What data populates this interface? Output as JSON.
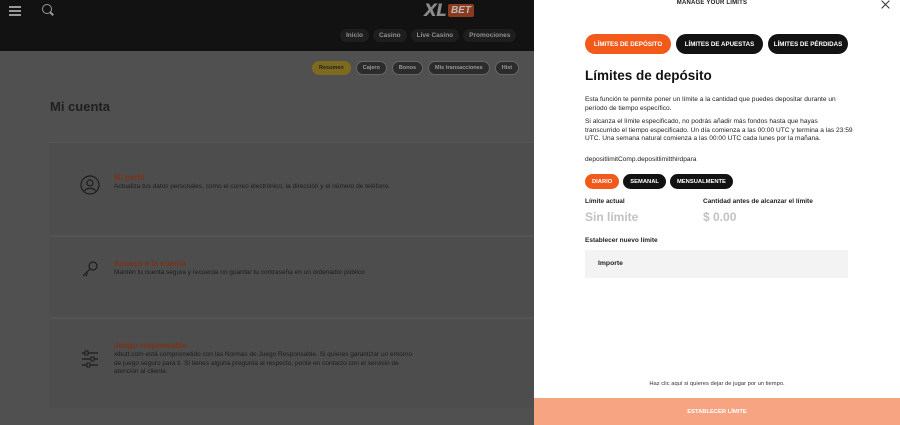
{
  "background": {
    "logo": {
      "left": "XL",
      "right": "BET"
    },
    "main_nav": [
      "Inicio",
      "Casino",
      "Live Casino",
      "Promociones"
    ],
    "sub_nav": [
      {
        "label": "Resumen",
        "active": true
      },
      {
        "label": "Cajero",
        "active": false
      },
      {
        "label": "Bonos",
        "active": false
      },
      {
        "label": "Mis transacciones",
        "active": false
      },
      {
        "label": "Hist",
        "active": false
      }
    ],
    "page_title": "Mi cuenta",
    "cards": [
      {
        "icon": "user-icon",
        "title": "Mi perfil",
        "text": "Actualiza tus datos personales, como el correo electrónico, la dirección y el número de teléfono."
      },
      {
        "icon": "key-icon",
        "title": "Acceso a la cuenta",
        "text": "Mantén tu cuenta segura y recuerda no guardar tu contraseña en un ordenador público"
      },
      {
        "icon": "sliders-icon",
        "title": "Juego responsable",
        "text": "xlbutt.com está comprometido con las Normas de Juego Responsable. Si quieres garantizar un entorno de juego seguro para ti. Si tienes alguna pregunta al respecto, ponte en contacto con el servicio de atención al cliente."
      }
    ]
  },
  "panel": {
    "title": "MANAGE YOUR LIMITS",
    "tabs": [
      {
        "label": "LÍMITES DE DEPÓSITO",
        "active": true
      },
      {
        "label": "LÍMITES DE APUESTAS",
        "active": false
      },
      {
        "label": "LÍMITES DE PÉRDIDAS",
        "active": false
      }
    ],
    "heading": "Límites de depósito",
    "para1": "Esta función te permite poner un límite a la cantidad que puedes depositar durante un período de tiempo específico.",
    "para2": "Si alcanza el límite especificado, no podrás añadir más fondos hasta que hayas transcurrido el tiempo especificado. Un día comienza a las 00:00 UTC y termina a las 23:59 UTC. Una semana natural comienza a las 00:00 UTC cada lunes por la mañana.",
    "para3": "depositlimitComp.depositlimitthirdpara",
    "periods": [
      {
        "label": "DIARIO",
        "active": true
      },
      {
        "label": "SEMANAL",
        "active": false
      },
      {
        "label": "MENSUALMENTE",
        "active": false
      }
    ],
    "current_limit_label": "Límite actual",
    "current_limit_value": "Sin límite",
    "remaining_label": "Cantidad antes de alcanzar el límite",
    "remaining_value": "$ 0.00",
    "new_limit_label": "Establecer nuevo límite",
    "amount_placeholder": "Importe",
    "stop_link": "Haz clic aquí si quieres dejar de jugar por un tiempo.",
    "submit_label": "ESTABLECER LÍMITE"
  },
  "colors": {
    "accent": "#f25a1c",
    "accent_disabled": "#f7a483",
    "dark": "#121212"
  }
}
